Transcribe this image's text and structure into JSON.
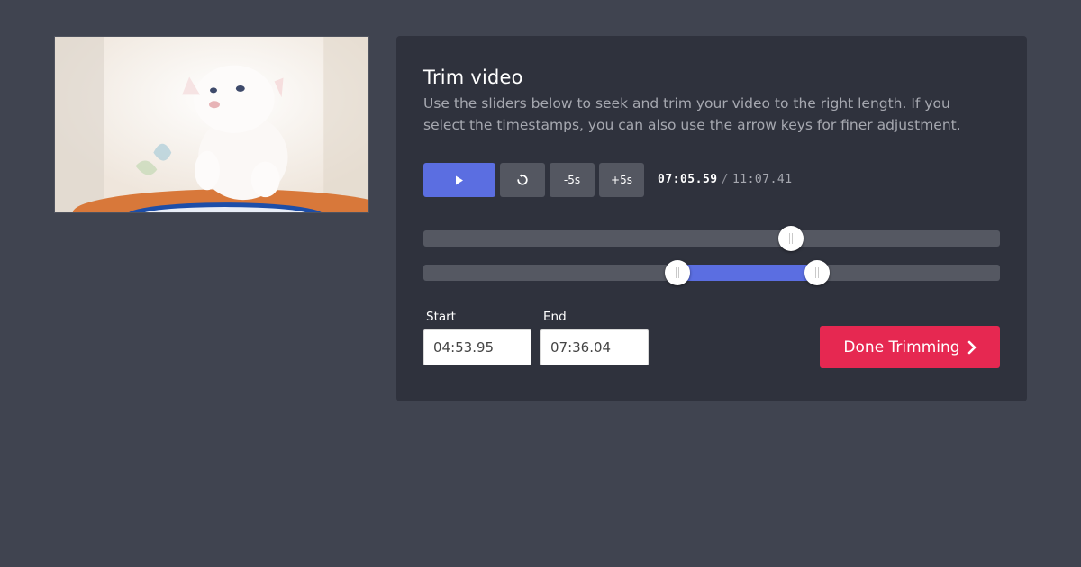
{
  "panel": {
    "title": "Trim video",
    "description": "Use the sliders below to seek and trim your video to the right length. If you select the timestamps, you can also use the arrow keys for finer adjustment."
  },
  "controls": {
    "play_icon": "play-icon",
    "replay_icon": "replay-icon",
    "back_label": "-5s",
    "forward_label": "+5s",
    "current_time": "07:05.59",
    "separator": "/",
    "total_time": "11:07.41"
  },
  "seek": {
    "position_fraction": 0.637
  },
  "trim": {
    "start_fraction": 0.441,
    "end_fraction": 0.683
  },
  "fields": {
    "start_label": "Start",
    "start_value": "04:53.95",
    "end_label": "End",
    "end_value": "07:36.04"
  },
  "done_button": {
    "label": "Done Trimming",
    "icon": "chevron-right-icon"
  },
  "colors": {
    "background": "#404450",
    "panel": "#2f323d",
    "accent": "#5b6ee1",
    "done": "#e62851",
    "secondary_button": "#545761"
  }
}
